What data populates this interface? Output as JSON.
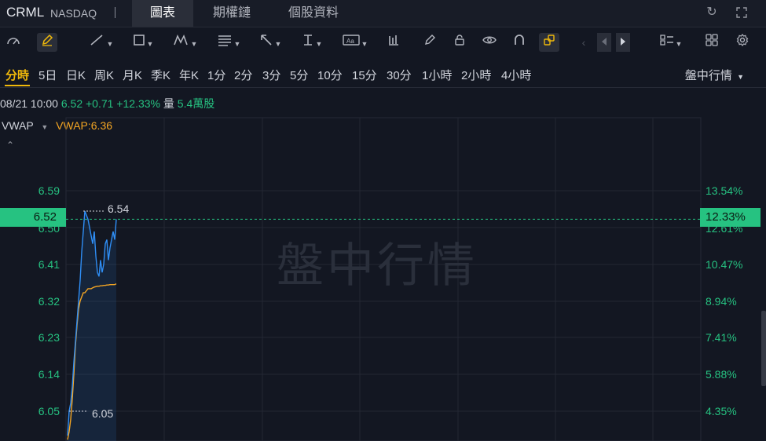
{
  "header": {
    "symbol": "CRML",
    "exchange": "NASDAQ",
    "tabs": [
      {
        "label": "圖表",
        "active": true
      },
      {
        "label": "期權鏈",
        "active": false
      },
      {
        "label": "個股資料",
        "active": false
      }
    ]
  },
  "toolbar": {
    "icons": [
      "speedometer-icon",
      "pencil-icon",
      "line-tool-icon",
      "rectangle-tool-icon",
      "pattern-tool-icon",
      "fib-tool-icon",
      "arrow-tool-icon",
      "measure-tool-icon",
      "text-tool-icon",
      "indicators-icon",
      "edit-icon",
      "lock-icon",
      "eye-icon",
      "magnet-icon",
      "link-icon",
      "prev-icon",
      "next-icon",
      "layout-icon",
      "grid-icon",
      "settings-icon"
    ]
  },
  "periods": {
    "items": [
      "分時",
      "5日",
      "日K",
      "周K",
      "月K",
      "季K",
      "年K",
      "1分",
      "2分",
      "3分",
      "5分",
      "10分",
      "15分",
      "30分",
      "1小時",
      "2小時",
      "4小時"
    ],
    "active_index": 0,
    "market_mode": "盤中行情"
  },
  "quote": {
    "datetime": "08/21 10:00",
    "price": "6.52",
    "change": "+0.71",
    "change_pct": "+12.33%",
    "volume_label": "量",
    "volume": "5.4萬股"
  },
  "indicator": {
    "name": "VWAP",
    "value_label": "VWAP:6.36"
  },
  "chart_data": {
    "type": "line",
    "watermark": "盤中行情",
    "y_left_ticks": [
      "6.59",
      "6.50",
      "6.41",
      "6.32",
      "6.23",
      "6.14",
      "6.05"
    ],
    "y_right_ticks": [
      "13.54%",
      "12.61%",
      "10.47%",
      "8.94%",
      "7.41%",
      "5.88%",
      "4.35%"
    ],
    "ylim": [
      5.98,
      6.64
    ],
    "current_price": "6.52",
    "current_pct": "12.33%",
    "high_label": "6.54",
    "low_label": "6.05",
    "colors": {
      "price": "#2f8ef5",
      "vwap": "#f5a623",
      "up": "#26c281"
    },
    "series": [
      {
        "name": "price",
        "values": [
          5.99,
          6.05,
          6.07,
          6.11,
          6.17,
          6.22,
          6.27,
          6.32,
          6.37,
          6.44,
          6.49,
          6.54,
          6.53,
          6.52,
          6.5,
          6.48,
          6.46,
          6.49,
          6.43,
          6.39,
          6.38,
          6.42,
          6.39,
          6.41,
          6.46,
          6.47,
          6.42,
          6.45,
          6.47,
          6.49,
          6.47,
          6.52
        ]
      },
      {
        "name": "VWAP",
        "values": [
          5.98,
          6.0,
          6.03,
          6.08,
          6.14,
          6.21,
          6.26,
          6.3,
          6.32,
          6.33,
          6.34,
          6.34,
          6.345,
          6.35,
          6.35,
          6.35,
          6.352,
          6.354,
          6.355,
          6.356,
          6.356,
          6.357,
          6.357,
          6.358,
          6.358,
          6.359,
          6.359,
          6.36,
          6.36,
          6.36,
          6.36,
          6.362
        ]
      }
    ]
  }
}
